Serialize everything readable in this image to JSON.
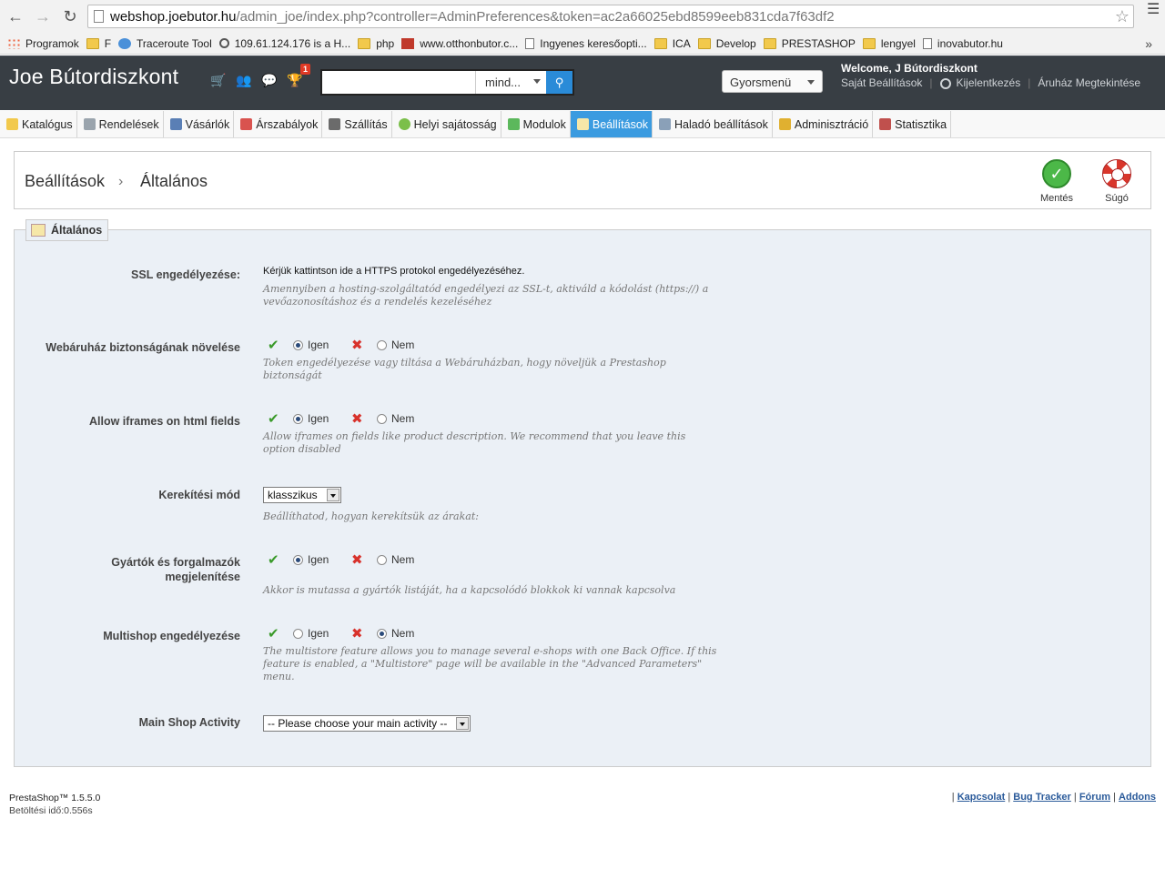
{
  "browser": {
    "url_host": "webshop.joebutor.hu",
    "url_path": "/admin_joe/index.php?controller=AdminPreferences&token=ac2a66025ebd8599eeb831cda7f63df2",
    "bookmarks": [
      {
        "label": "Programok",
        "icon": "apps-icon"
      },
      {
        "label": "F",
        "icon": "folder-icon"
      },
      {
        "label": "Traceroute Tool",
        "icon": "globe-icon"
      },
      {
        "label": "109.61.124.176 is a H...",
        "icon": "search-icon"
      },
      {
        "label": "php",
        "icon": "folder-icon"
      },
      {
        "label": "www.otthonbutor.c...",
        "icon": "site-icon"
      },
      {
        "label": "Ingyenes keresőopti...",
        "icon": "page-icon"
      },
      {
        "label": "ICA",
        "icon": "folder-icon"
      },
      {
        "label": "Develop",
        "icon": "folder-icon"
      },
      {
        "label": "PRESTASHOP",
        "icon": "folder-icon"
      },
      {
        "label": "lengyel",
        "icon": "folder-icon"
      },
      {
        "label": "inovabutor.hu",
        "icon": "page-icon"
      }
    ],
    "more": "»"
  },
  "header": {
    "shop_name": "Joe Bútordiszkont",
    "notification_count": "1",
    "search_placeholder": "",
    "search_scope": "mind...",
    "quick_menu": "Gyorsmenü",
    "welcome_prefix": "Welcome, ",
    "welcome_user": "J Bútordiszkont",
    "links": {
      "my_settings": "Saját Beállítások",
      "logout": "Kijelentkezés",
      "view_shop": "Áruház Megtekintése"
    }
  },
  "tabs": [
    {
      "label": "Katalógus",
      "icon": "folder-icon",
      "active": false
    },
    {
      "label": "Rendelések",
      "icon": "cart-icon",
      "active": false
    },
    {
      "label": "Vásárlók",
      "icon": "user-icon",
      "active": false
    },
    {
      "label": "Árszabályok",
      "icon": "price-icon",
      "active": false
    },
    {
      "label": "Szállítás",
      "icon": "truck-icon",
      "active": false
    },
    {
      "label": "Helyi sajátosság",
      "icon": "globe-icon",
      "active": false
    },
    {
      "label": "Modulok",
      "icon": "puzzle-icon",
      "active": false
    },
    {
      "label": "Beállítások",
      "icon": "settings-icon",
      "active": true
    },
    {
      "label": "Haladó beállítások",
      "icon": "wrench-icon",
      "active": false
    },
    {
      "label": "Adminisztráció",
      "icon": "key-icon",
      "active": false
    },
    {
      "label": "Statisztika",
      "icon": "chart-icon",
      "active": false
    }
  ],
  "breadcrumb": {
    "parent": "Beállítások",
    "separator": "›",
    "current": "Általános"
  },
  "toolbar": {
    "save_label": "Mentés",
    "help_label": "Súgó"
  },
  "form": {
    "legend": "Általános",
    "yes_label": "Igen",
    "no_label": "Nem",
    "ssl": {
      "label": "SSL engedélyezése:",
      "link_text": "Kérjük kattintson ide a HTTPS protokol engedélyezéséhez.",
      "hint": "Amennyiben a hosting-szolgáltatód engedélyezi az SSL-t, aktiváld a kódolást (https://) a vevőazonosításhoz és a rendelés kezeléséhez"
    },
    "security": {
      "label": "Webáruház biztonságának növelése",
      "value": "yes",
      "hint": "Token engedélyezése vagy tiltása a Webáruházban, hogy növeljük a Prestashop biztonságát"
    },
    "iframes": {
      "label": "Allow iframes on html fields",
      "value": "yes",
      "hint": "Allow iframes on fields like product description. We recommend that you leave this option disabled"
    },
    "rounding": {
      "label": "Kerekítési mód",
      "selected": "klasszikus",
      "hint": "Beállíthatod, hogyan kerekítsük az árakat:"
    },
    "manufacturers": {
      "label_line1": "Gyártók és forgalmazók",
      "label_line2": "megjelenítése",
      "value": "yes",
      "hint": "Akkor is mutassa a gyártók listáját, ha a kapcsolódó blokkok ki vannak kapcsolva"
    },
    "multishop": {
      "label": "Multishop engedélyezése",
      "value": "no",
      "hint": "The multistore feature allows you to manage several e-shops with one Back Office. If this feature is enabled, a \"Multistore\" page will be available in the \"Advanced Parameters\" menu."
    },
    "activity": {
      "label": "Main Shop Activity",
      "selected": "-- Please choose your main activity --"
    }
  },
  "footer": {
    "version": "PrestaShop™ 1.5.5.0",
    "load_time": "Betöltési idő:0.556s",
    "links": [
      "Kapcsolat",
      "Bug Tracker",
      "Fórum",
      "Addons"
    ]
  },
  "colors": {
    "header_bg": "#383e44",
    "active_tab": "#3b9be0",
    "fieldset_bg": "#ebf0f6",
    "search_btn": "#2a8bd8"
  }
}
